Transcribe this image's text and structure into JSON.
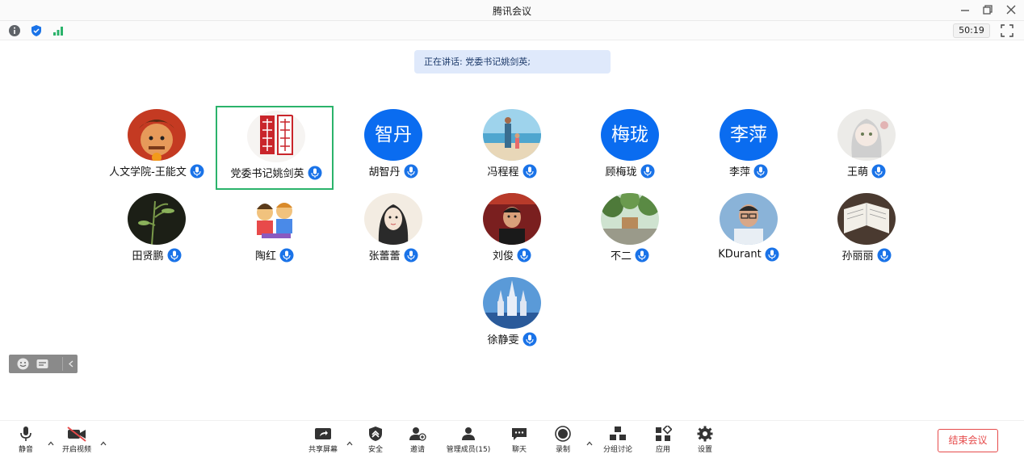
{
  "window": {
    "title": "腾讯会议"
  },
  "status": {
    "timer": "50:19"
  },
  "speaking": {
    "text": "正在讲话: 党委书记姚剑英;"
  },
  "participants": [
    {
      "name": "人文学院-王能文",
      "avatar": "photo-cartoon",
      "initials": ""
    },
    {
      "name": "党委书记姚剑英",
      "avatar": "photo-seal",
      "initials": ""
    },
    {
      "name": "胡智丹",
      "avatar": "initials",
      "initials": "智丹"
    },
    {
      "name": "冯程程",
      "avatar": "photo-beach",
      "initials": ""
    },
    {
      "name": "顾梅珑",
      "avatar": "initials",
      "initials": "梅珑"
    },
    {
      "name": "李萍",
      "avatar": "initials",
      "initials": "李萍"
    },
    {
      "name": "王萌",
      "avatar": "photo-anime",
      "initials": ""
    },
    {
      "name": "田贤鹏",
      "avatar": "photo-plant",
      "initials": ""
    },
    {
      "name": "陶红",
      "avatar": "photo-kids",
      "initials": ""
    },
    {
      "name": "张蕾蕾",
      "avatar": "photo-girl",
      "initials": ""
    },
    {
      "name": "刘俊",
      "avatar": "photo-man",
      "initials": ""
    },
    {
      "name": "不二",
      "avatar": "photo-park",
      "initials": ""
    },
    {
      "name": "KDurant",
      "avatar": "photo-glasses",
      "initials": ""
    },
    {
      "name": "孙丽丽",
      "avatar": "photo-book",
      "initials": ""
    },
    {
      "name": "徐静雯",
      "avatar": "photo-castle",
      "initials": ""
    }
  ],
  "bottombar": {
    "mute": "静音",
    "video": "开启视频",
    "share": "共享屏幕",
    "security": "安全",
    "invite": "邀请",
    "members": "管理成员(15)",
    "chat": "聊天",
    "record": "录制",
    "breakout": "分组讨论",
    "apps": "应用",
    "settings": "设置",
    "end": "结束会议"
  },
  "colors": {
    "accent": "#0a6cf0",
    "active_border": "#2bb36b",
    "end": "#e64b4b"
  }
}
